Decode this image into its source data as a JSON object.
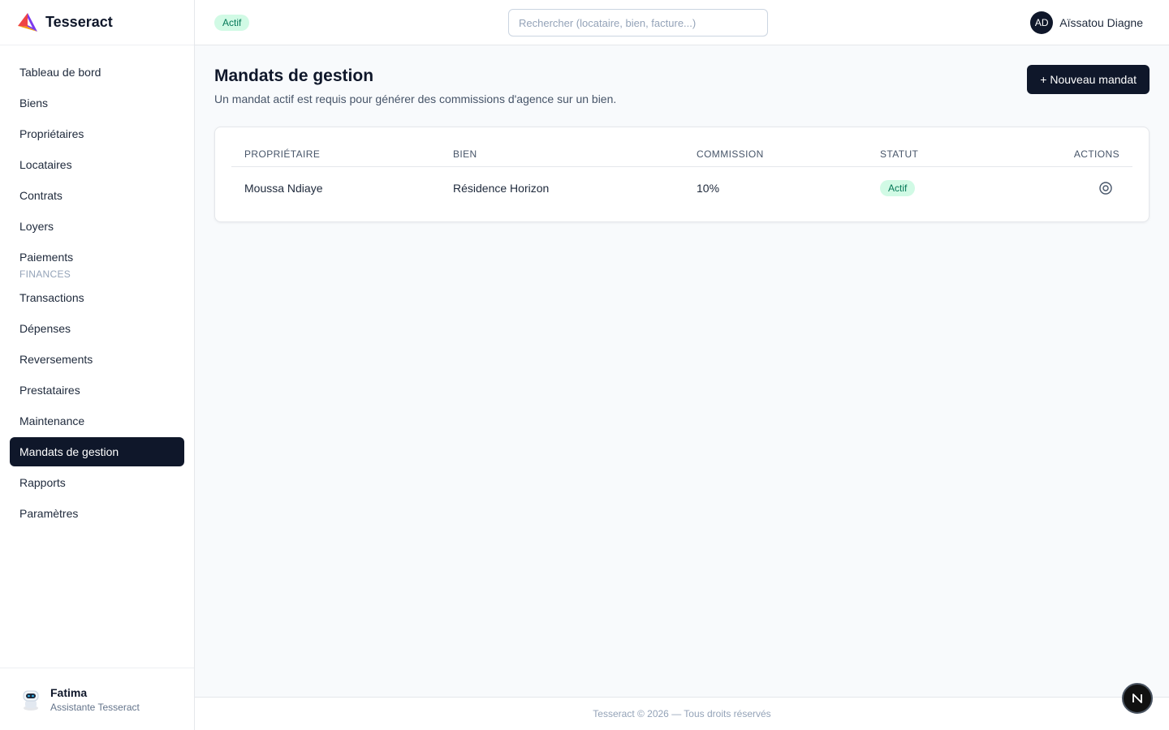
{
  "brand": {
    "name": "Tesseract"
  },
  "sidebar": {
    "items": [
      {
        "label": "Tableau de bord"
      },
      {
        "label": "Biens"
      },
      {
        "label": "Propriétaires"
      },
      {
        "label": "Locataires"
      },
      {
        "label": "Contrats"
      },
      {
        "label": "Loyers"
      },
      {
        "label": "Paiements"
      }
    ],
    "section_finances": "FINANCES",
    "finance_items": [
      {
        "label": "Transactions"
      },
      {
        "label": "Dépenses"
      },
      {
        "label": "Reversements"
      },
      {
        "label": "Prestataires"
      },
      {
        "label": "Maintenance"
      },
      {
        "label": "Mandats de gestion",
        "active": true
      },
      {
        "label": "Rapports"
      },
      {
        "label": "Paramètres"
      }
    ],
    "assistant": {
      "name": "Fatima",
      "role": "Assistante Tesseract"
    }
  },
  "topbar": {
    "status_badge": "Actif",
    "search_placeholder": "Rechercher (locataire, bien, facture...)",
    "user": {
      "initials": "AD",
      "name": "Aïssatou Diagne"
    }
  },
  "main": {
    "title": "Mandats de gestion",
    "subtitle": "Un mandat actif est requis pour générer des commissions d'agence sur un bien.",
    "new_button": "+ Nouveau mandat",
    "table": {
      "columns": [
        "PROPRIÉTAIRE",
        "BIEN",
        "COMMISSION",
        "STATUT",
        "ACTIONS"
      ],
      "rows": [
        {
          "owner": "Moussa Ndiaye",
          "property": "Résidence Horizon",
          "commission": "10%",
          "status": "Actif",
          "action_icon": "target-icon"
        }
      ]
    }
  },
  "footer": {
    "text": "Tesseract © 2026 — Tous droits réservés"
  },
  "fab": {
    "label": "N"
  },
  "colors": {
    "primary": "#0f172a",
    "success_bg": "#d1fae5",
    "success_text": "#047857"
  }
}
